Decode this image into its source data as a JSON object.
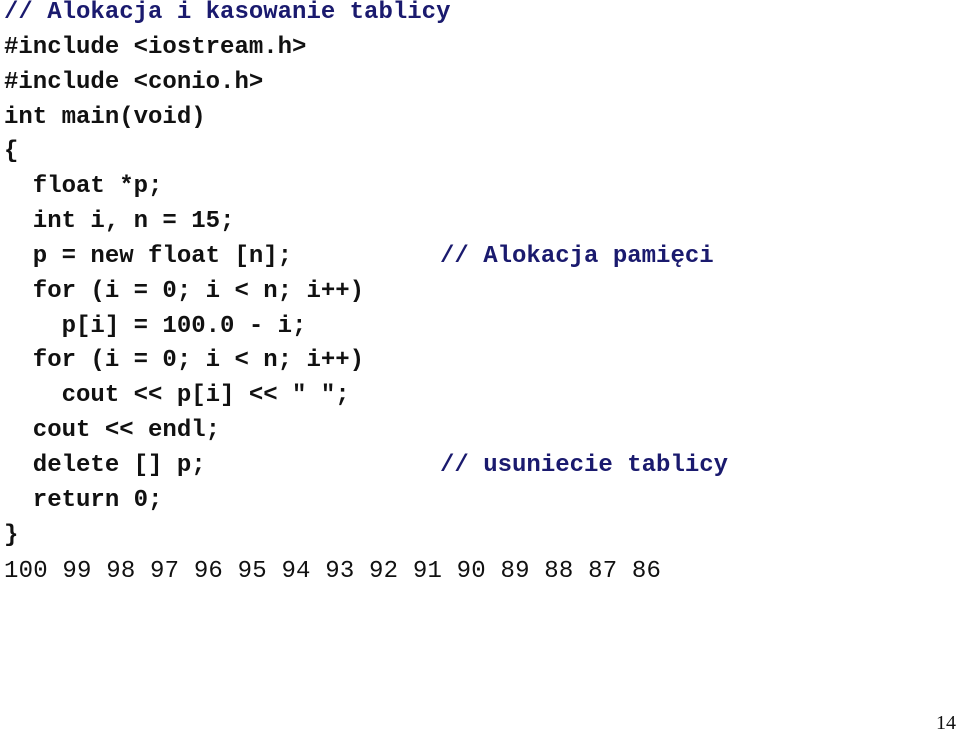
{
  "code": {
    "title_comment": "// Alokacja i kasowanie tablicy",
    "lines": [
      "#include <iostream.h>",
      "#include <conio.h>",
      "int main(void)",
      "{",
      "  float *p;",
      "  int i, n = 15;",
      "  p = new float [n];",
      "  for (i = 0; i < n; i++)",
      "    p[i] = 100.0 - i;",
      "  for (i = 0; i < n; i++)",
      "    cout << p[i] << \" \";",
      "  cout << endl;",
      "  delete [] p;",
      "  return 0;",
      "}"
    ],
    "comment_alloc": "// Alokacja pamięci",
    "comment_delete": "// usuniecie tablicy"
  },
  "output": "100 99 98 97 96 95 94 93 92 91 90 89 88 87 86",
  "page_number": "14",
  "colors": {
    "code_text": "#111111",
    "comment": "#1a1a6e",
    "background": "#ffffff"
  }
}
